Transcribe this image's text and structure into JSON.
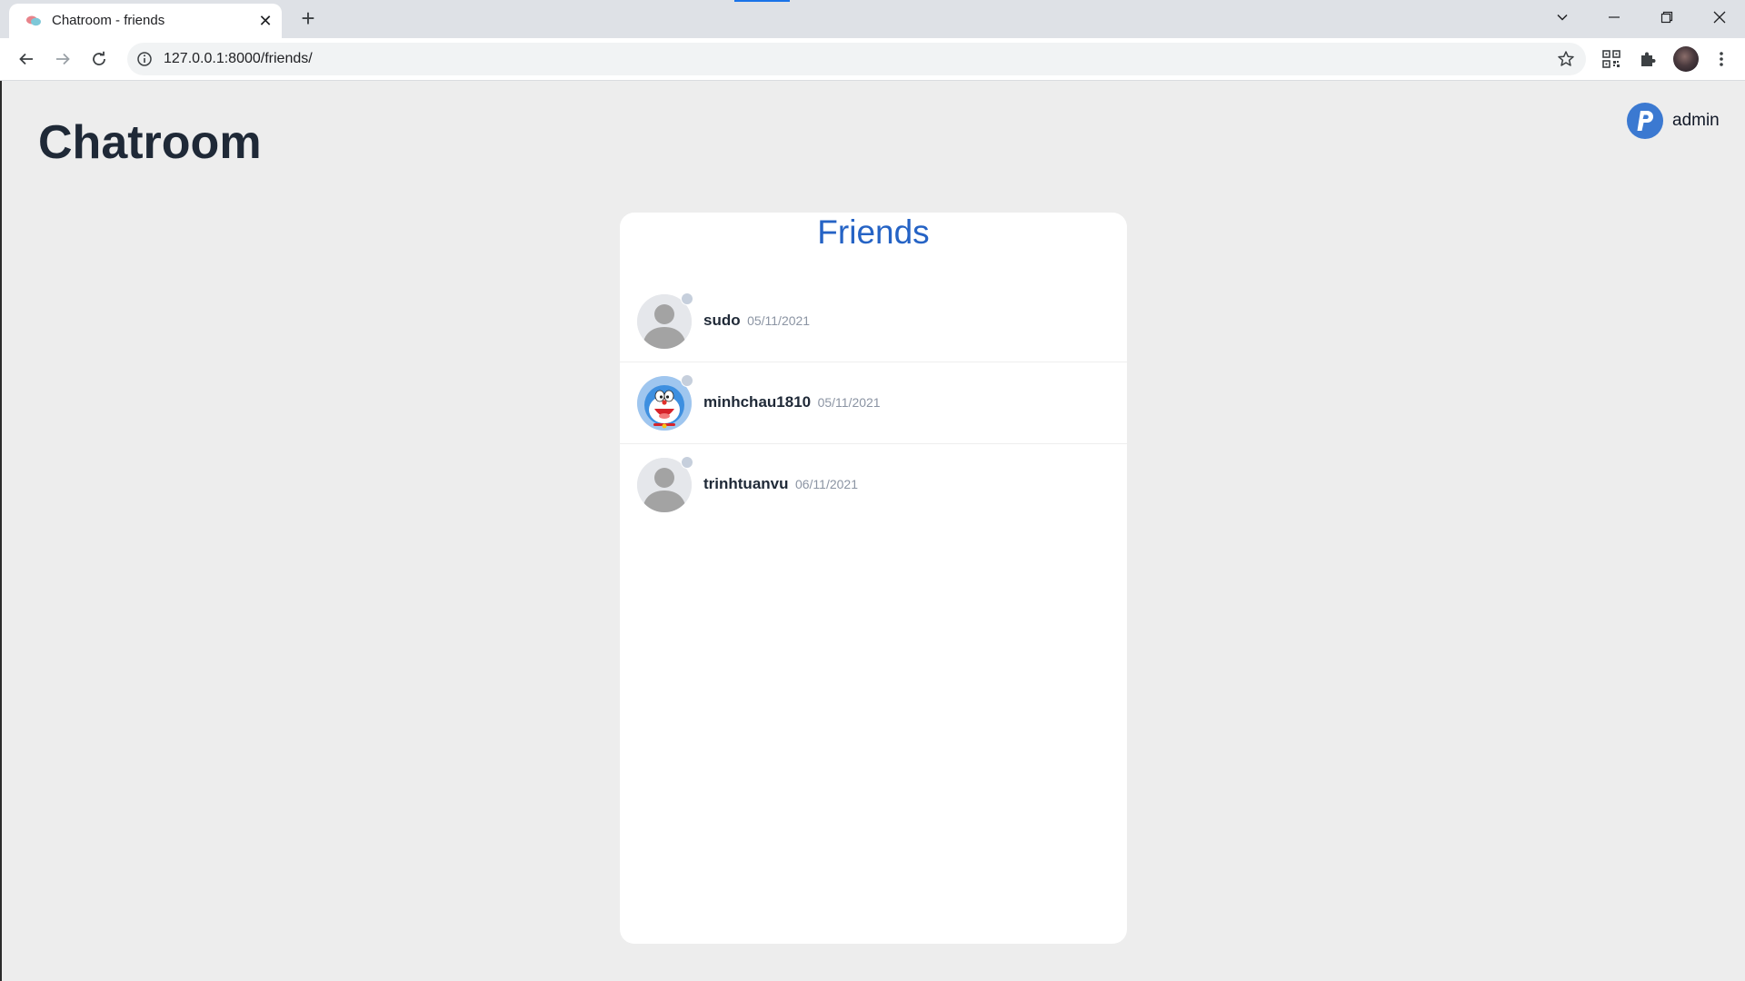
{
  "browser": {
    "tab_title": "Chatroom - friends",
    "url": "127.0.0.1:8000/friends/",
    "icons": {
      "favicon": "chat-bubbles-icon",
      "tab_close": "close-icon",
      "new_tab": "plus-icon",
      "back": "arrow-left-icon",
      "forward": "arrow-right-icon",
      "reload": "reload-icon",
      "site_info": "info-icon",
      "bookmark": "star-icon",
      "qr": "qr-code-icon",
      "extensions": "puzzle-icon",
      "menu": "kebab-menu-icon"
    }
  },
  "header": {
    "brand": "Chatroom",
    "user": {
      "name": "admin",
      "avatar_letter": "P",
      "avatar_color": "#3b79d1"
    }
  },
  "friends_panel": {
    "title": "Friends",
    "title_color": "#2563c5",
    "items": [
      {
        "name": "sudo",
        "date": "05/11/2021",
        "avatar": "default-user-icon"
      },
      {
        "name": "minhchau1810",
        "date": "05/11/2021",
        "avatar": "doraemon-avatar"
      },
      {
        "name": "trinhtuanvu",
        "date": "06/11/2021",
        "avatar": "default-user-icon"
      }
    ]
  }
}
